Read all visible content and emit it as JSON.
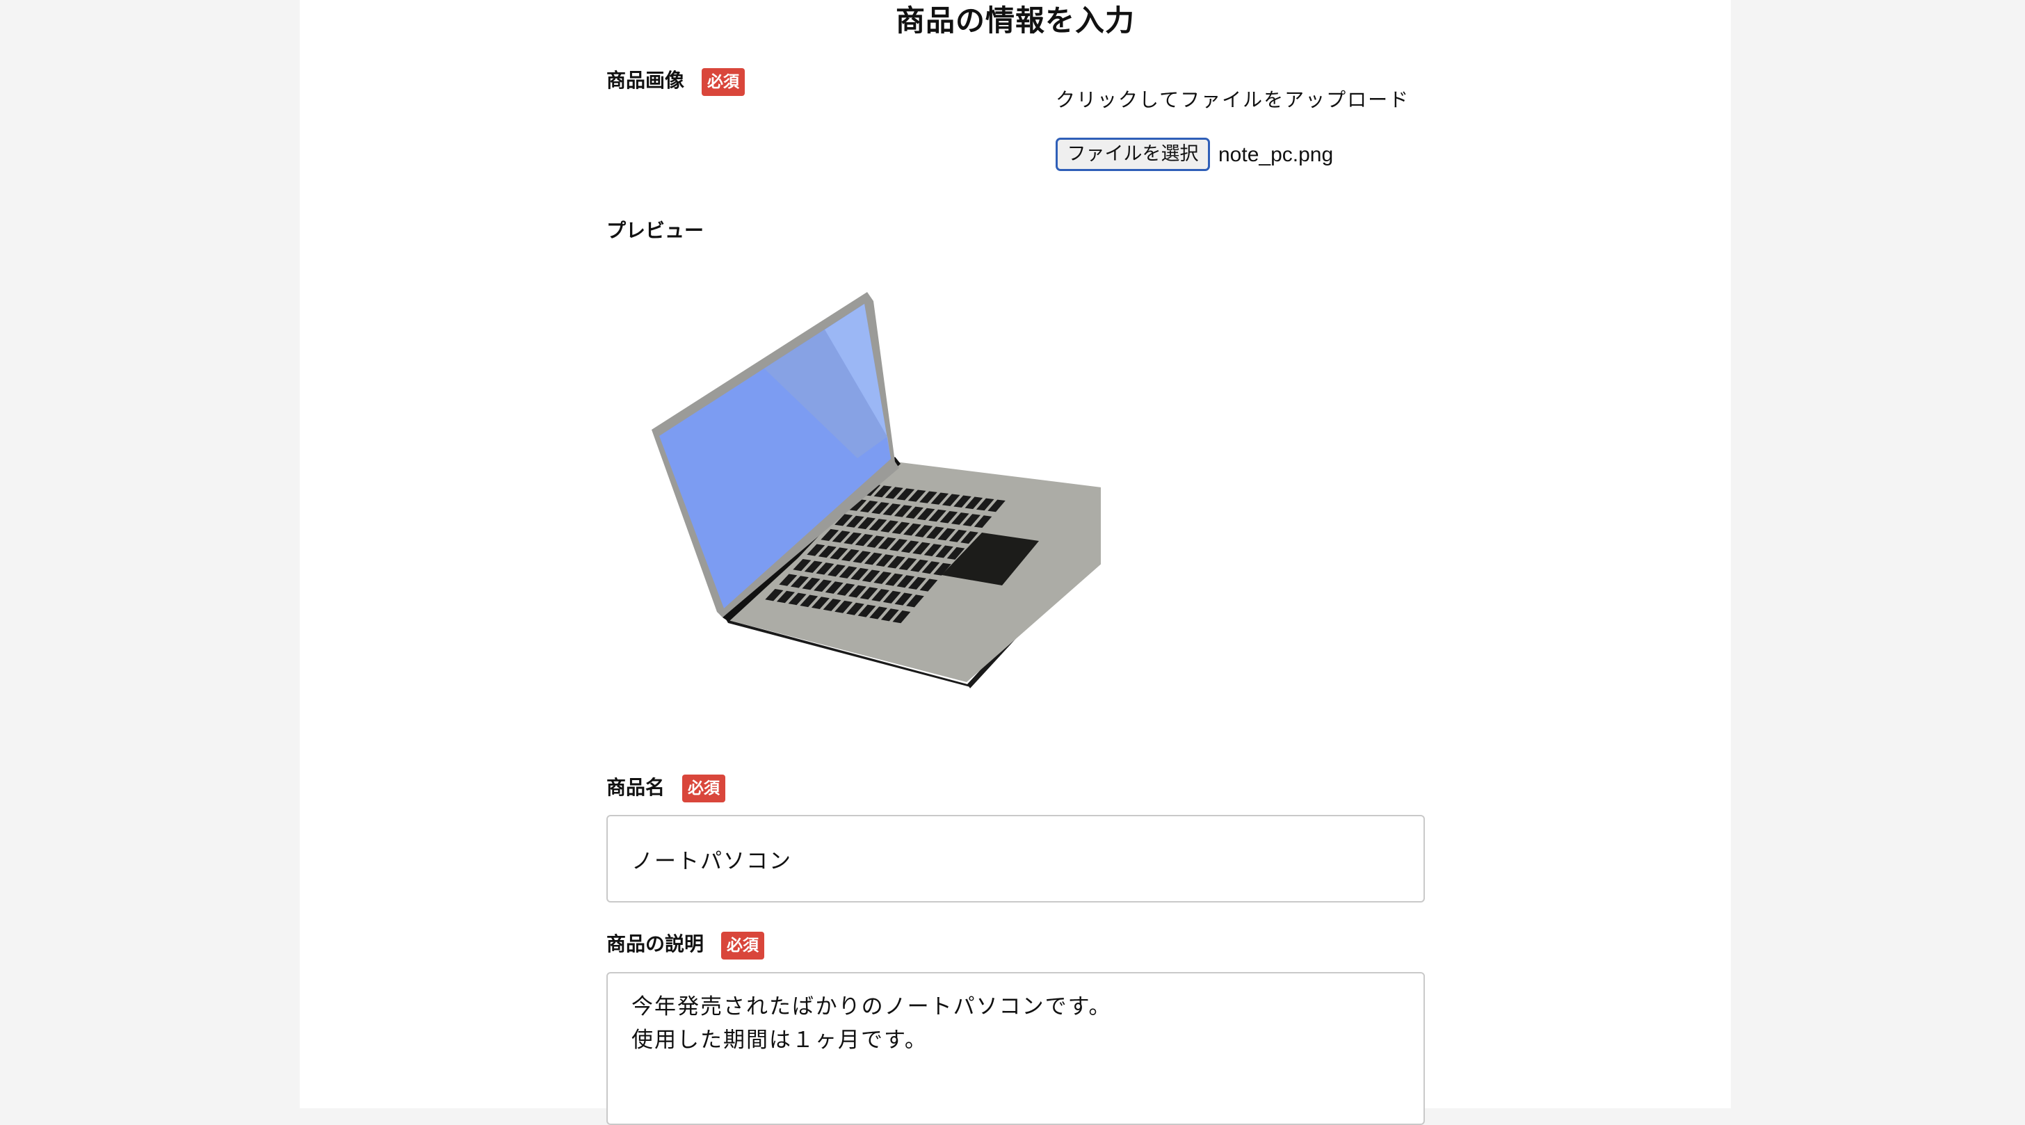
{
  "form": {
    "title": "商品の情報を入力",
    "required_badge": "必須",
    "image": {
      "label": "商品画像",
      "upload_hint": "クリックしてファイルをアップロード",
      "choose_file_label": "ファイルを選択",
      "file_name": "note_pc.png"
    },
    "preview": {
      "label": "プレビュー",
      "image_icon": "laptop-image"
    },
    "name": {
      "label": "商品名",
      "value": "ノートパソコン"
    },
    "description": {
      "label": "商品の説明",
      "value": "今年発売されたばかりのノートパソコンです。\n使用した期間は１ヶ月です。"
    }
  },
  "colors": {
    "required_badge": "#d9463b",
    "button_focus_border": "#2f5fb8",
    "page_background": "#f4f4f4",
    "content_background": "#ffffff"
  }
}
